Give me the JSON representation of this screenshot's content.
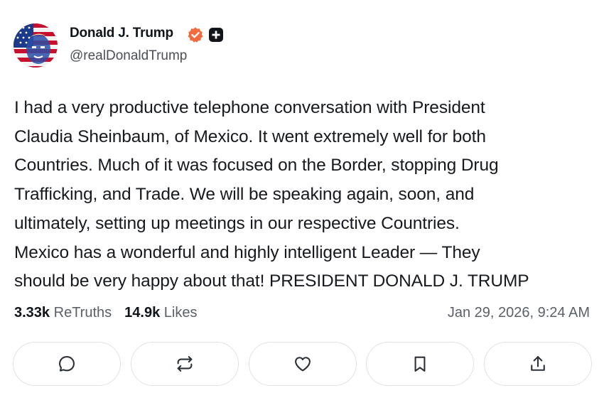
{
  "post": {
    "author": {
      "display_name": "Donald J. Trump",
      "handle": "@realDonaldTrump",
      "avatar_icon": "avatar-flag-portrait",
      "verified_icon": "verified-badge-icon",
      "verified_color": "#f26a3d",
      "plus_icon": "plus-badge-icon"
    },
    "body_lines": [
      "I had a very productive telephone conversation with President",
      "Claudia Sheinbaum, of Mexico. It went extremely well for both",
      "Countries. Much of it was focused on the Border, stopping Drug",
      "Trafficking, and Trade. We will be speaking again, soon, and",
      "ultimately, setting up meetings in our respective Countries.",
      "Mexico has a wonderful and highly intelligent Leader — They",
      "should be very happy about that! PRESIDENT DONALD J. TRUMP"
    ],
    "stats": {
      "retruths_count": "3.33k",
      "retruths_label": "ReTruths",
      "likes_count": "14.9k",
      "likes_label": "Likes"
    },
    "timestamp": "Jan 29, 2026, 9:24 AM",
    "actions": [
      {
        "name": "reply",
        "icon": "comment-icon"
      },
      {
        "name": "retruth",
        "icon": "repost-icon"
      },
      {
        "name": "like",
        "icon": "heart-icon"
      },
      {
        "name": "bookmark",
        "icon": "bookmark-icon"
      },
      {
        "name": "share",
        "icon": "share-icon"
      }
    ]
  }
}
